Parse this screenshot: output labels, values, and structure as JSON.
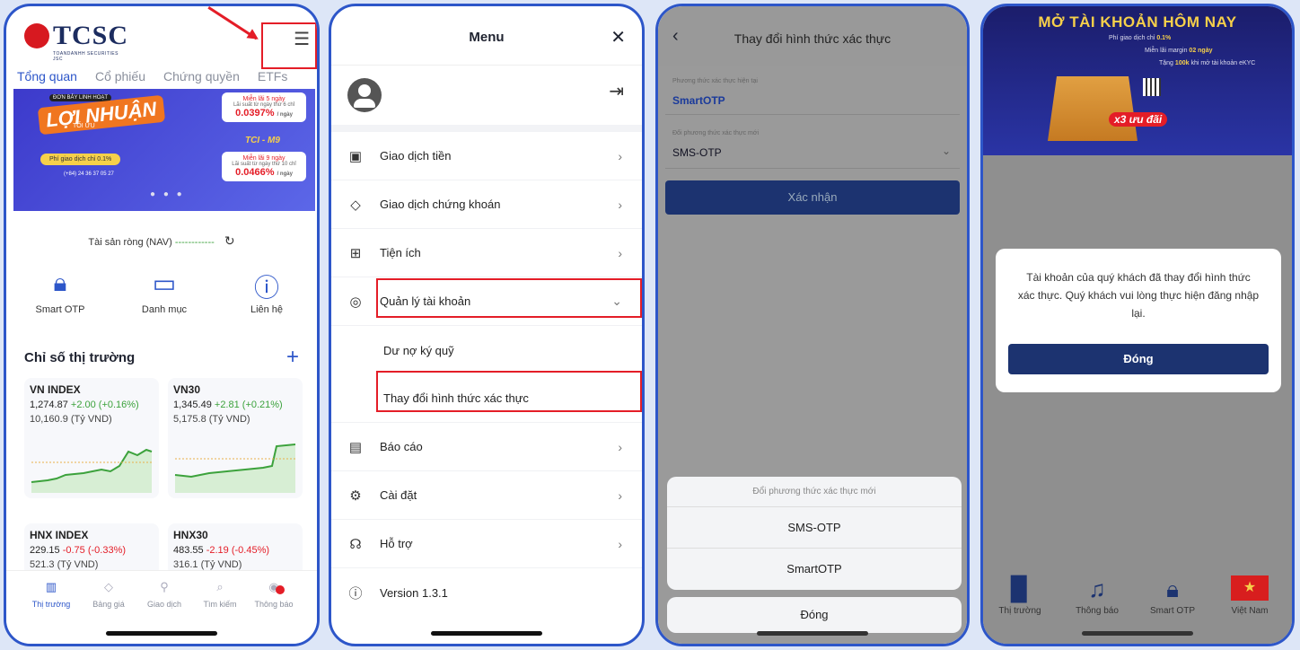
{
  "phone1": {
    "logo": "TCSC",
    "logo_sub": "TOANDANHH SECURITIES JSC",
    "tabs": [
      "Tổng quan",
      "Cổ phiếu",
      "Chứng quyền",
      "ETFs"
    ],
    "banner": {
      "tag": "ĐƠN BẢY LINH HOẠT",
      "title": "LỢI NHUẬN",
      "title_sub": "TỐI ƯU",
      "fee": "Phí giao dịch chỉ 0.1%",
      "phone": "(+84) 24 36 37 05 27",
      "card1_head": "Miễn lãi 5 ngày",
      "card1_sub": "Lãi suất từ ngày thứ 6 chỉ",
      "card1_rate": "0.0397%",
      "card1_unit": "/ ngày",
      "tci": "TCI - M9",
      "card2_head": "Miễn lãi 9 ngày",
      "card2_sub": "Lãi suất từ ngày thứ 10 chỉ",
      "card2_rate": "0.0466%",
      "card2_unit": "/ ngày"
    },
    "nav_label": "Tài sản ròng (NAV)",
    "nav_value": "------------",
    "quick_actions": [
      "Smart OTP",
      "Danh mục",
      "Liên hệ"
    ],
    "market_title": "Chỉ số thị trường",
    "indices": [
      {
        "name": "VN INDEX",
        "value": "1,274.87",
        "change": "+2.00 (+0.16%)",
        "volume": "10,160.9 (Tỷ VND)"
      },
      {
        "name": "VN30",
        "value": "1,345.49",
        "change": "+2.81 (+0.21%)",
        "volume": "5,175.8 (Tỷ VND)"
      },
      {
        "name": "HNX INDEX",
        "value": "229.15",
        "change": "-0.75 (-0.33%)",
        "volume": "521.3 (Tỷ VND)"
      },
      {
        "name": "HNX30",
        "value": "483.55",
        "change": "-2.19 (-0.45%)",
        "volume": "316.1 (Tỷ VND)"
      }
    ],
    "tabbar": [
      "Thị trường",
      "Bảng giá",
      "Giao dịch",
      "Tìm kiếm",
      "Thông báo"
    ]
  },
  "phone2": {
    "title": "Menu",
    "items": [
      {
        "label": "Giao dịch tiền"
      },
      {
        "label": "Giao dịch chứng khoán"
      },
      {
        "label": "Tiện ích"
      },
      {
        "label": "Quản lý tài khoản"
      },
      {
        "label": "Dư nợ ký quỹ"
      },
      {
        "label": "Thay đổi hình thức xác thực"
      },
      {
        "label": "Báo cáo"
      },
      {
        "label": "Cài đặt"
      },
      {
        "label": "Hỗ trợ"
      },
      {
        "label": "Version 1.3.1"
      }
    ]
  },
  "phone3": {
    "title": "Thay đổi hình thức xác thực",
    "current_label": "Phương thức xác thực hiện tại",
    "current_value": "SmartOTP",
    "new_label": "Đổi phương thức xác thực mới",
    "new_value": "SMS-OTP",
    "confirm": "Xác nhận",
    "sheet_title": "Đổi phương thức xác thực mới",
    "options": [
      "SMS-OTP",
      "SmartOTP"
    ],
    "close": "Đóng"
  },
  "phone4": {
    "banner_title": "MỞ TÀI KHOẢN HÔM NAY",
    "line1_pre": "Phí giao dịch chỉ",
    "line1_val": "0.1%",
    "line2_pre": "Miễn lãi margin",
    "line2_val": "02 ngày",
    "line3_pre": "Tặng",
    "line3_val": "100k",
    "line3_post": "khi mở tài khoản eKYC",
    "badge": "x3 ưu đãi",
    "dialog_message": "Tài khoản của quý khách đã thay đổi hình thức xác thực. Quý khách vui lòng thực hiện đăng nhập lại.",
    "dialog_button": "Đóng",
    "tabbar": [
      "Thị trường",
      "Thông báo",
      "Smart OTP",
      "Việt Nam"
    ]
  },
  "colors": {
    "accent": "#2d56c9",
    "brand_red": "#d71920",
    "highlight": "#e41d27",
    "up": "#3ca23c",
    "down": "#e41d27",
    "primary_button": "#1c3370"
  }
}
